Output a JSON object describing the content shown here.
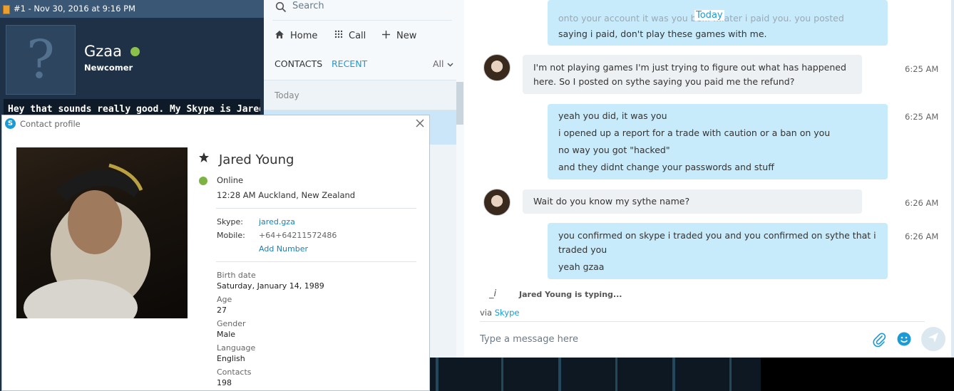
{
  "forum": {
    "header": "#1 - Nov 30, 2016 at 9:16 PM",
    "username": "Gzaa",
    "rank": "Newcomer",
    "post_text": "Hey that sounds really good. My Skype is Jared.gza"
  },
  "skype": {
    "search_placeholder": "Search",
    "nav": {
      "home": "Home",
      "call": "Call",
      "new": "New"
    },
    "tabs": {
      "contacts": "CONTACTS",
      "recent": "RECENT",
      "filter": "All"
    },
    "list_today": "Today"
  },
  "chat": {
    "today": "Today",
    "top_partial": [
      "onto your account it was you be... ...later i paid you. you posted",
      "saying i paid, don't play these games with me."
    ],
    "messages": [
      {
        "dir": "in",
        "lines": [
          "I'm not playing games I'm just trying to figure out what has happened",
          "here. So I posted on sythe saying you paid me the refund?"
        ],
        "time": "6:25 AM"
      },
      {
        "dir": "out",
        "lines": [
          "yeah you did, it was you",
          "i opened up a report for a trade with caution or a ban on you",
          "no way you got \"hacked\"",
          "and they didnt change your passwords and stuff"
        ],
        "time": "6:25 AM"
      },
      {
        "dir": "in",
        "lines": [
          "Wait do you know my sythe name?"
        ],
        "time": "6:26 AM"
      },
      {
        "dir": "out",
        "lines": [
          "you confirmed on skype i traded you and you confirmed on sythe that i",
          "traded you",
          "yeah gzaa"
        ],
        "time": "6:26 AM"
      }
    ],
    "typing": "Jared Young is typing...",
    "via_prefix": "via",
    "via_link": "Skype",
    "compose_placeholder": "Type a message here"
  },
  "profile": {
    "title": "Contact profile",
    "name": "Jared Young",
    "status": "Online",
    "local_time": "12:28 AM Auckland, New Zealand",
    "skype_label": "Skype:",
    "skype_value": "jared.gza",
    "mobile_label": "Mobile:",
    "mobile_value": "+64+64211572486",
    "add_number": "Add Number",
    "birth_label": "Birth date",
    "birth_value": "Saturday, January 14, 1989",
    "age_label": "Age",
    "age_value": "27",
    "gender_label": "Gender",
    "gender_value": "Male",
    "language_label": "Language",
    "language_value": "English",
    "contacts_label": "Contacts",
    "contacts_value": "198"
  },
  "colors": {
    "skype_blue": "#1a9bd7",
    "bubble_out": "#c7ebfb",
    "bubble_in": "#eef1f4",
    "online": "#7cb342",
    "forum_bg": "#1f3146"
  }
}
